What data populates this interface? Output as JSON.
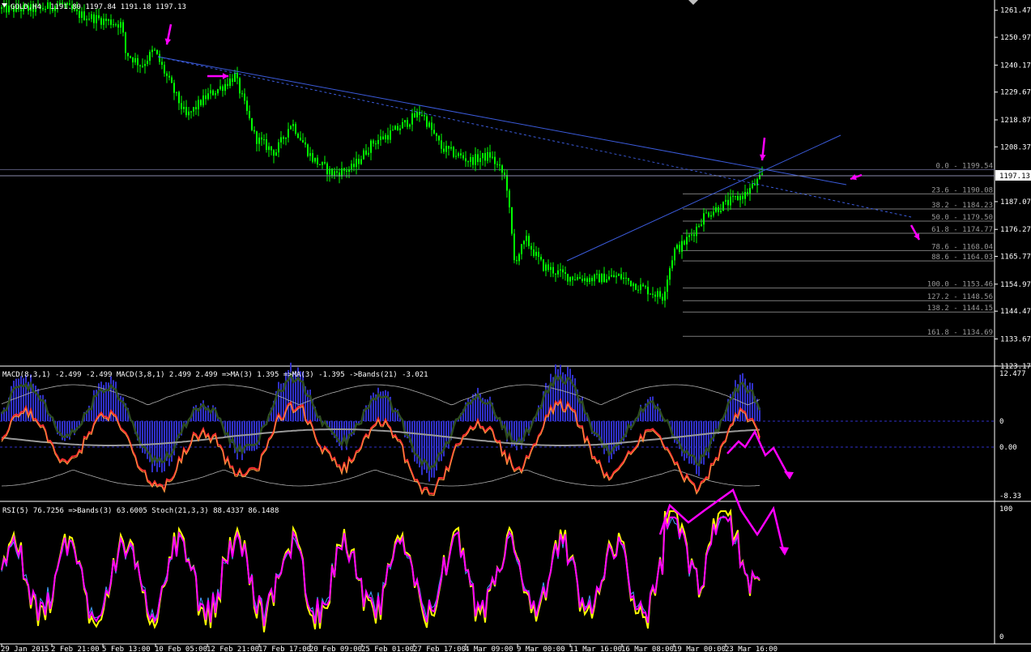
{
  "main": {
    "symbol_label": "GOLD,H4",
    "ohlc_text": "1191.80 1197.84 1191.18 1197.13",
    "current_price_label": "1197.13",
    "current_price": 1197.13,
    "price_ticks": [
      "1261.47",
      "1250.97",
      "1240.17",
      "1229.67",
      "1218.87",
      "1208.37",
      "1197.13",
      "1187.07",
      "1176.27",
      "1165.77",
      "1154.97",
      "1144.47",
      "1133.67",
      "1123.17"
    ],
    "fib_levels": [
      {
        "label": "0.0 - 1199.54",
        "value": 1199.54
      },
      {
        "label": "23.6 - 1190.08",
        "value": 1190.08
      },
      {
        "label": "38.2 - 1184.23",
        "value": 1184.23
      },
      {
        "label": "50.0 - 1179.50",
        "value": 1179.5
      },
      {
        "label": "61.8 - 1174.77",
        "value": 1174.77
      },
      {
        "label": "78.6 - 1168.04",
        "value": 1168.04
      },
      {
        "label": "88.6 - 1164.03",
        "value": 1164.03
      },
      {
        "label": "100.0 - 1153.46",
        "value": 1153.46
      },
      {
        "label": "127.2 - 1148.56",
        "value": 1148.56
      },
      {
        "label": "138.2 - 1144.15",
        "value": 1144.15
      },
      {
        "label": "161.8 - 1134.69",
        "value": 1134.69
      }
    ]
  },
  "macd": {
    "header": "MACD(8,3,1) -2.499 -2.499  MACD(3,8,1) 2.499 2.499  =>MA(3) 1.395  =>MA(3) -1.395  ->Bands(21) -3.021",
    "ticks": [
      "12.477",
      "0",
      "0.00",
      "-8.33"
    ]
  },
  "rsi": {
    "header": "RSI(5) 76.7256  =>Bands(3) 63.6005  Stoch(21,3,3) 88.4337 86.1488",
    "ticks": [
      "100",
      "0"
    ]
  },
  "time_labels": [
    "29 Jan 2015",
    "2 Feb 21:00",
    "5 Feb 13:00",
    "10 Feb 05:00",
    "12 Feb 21:00",
    "17 Feb 17:00",
    "20 Feb 09:00",
    "25 Feb 01:00",
    "27 Feb 17:00",
    "4 Mar 09:00",
    "9 Mar 00:00",
    "11 Mar 16:00",
    "16 Mar 08:00",
    "19 Mar 00:00",
    "23 Mar 16:00"
  ],
  "colors": {
    "background": "#000000",
    "candle": "#00ff00",
    "trendline": "#3b5bdb",
    "fib": "#7a7a7a",
    "arrow": "#ff00ff",
    "macd_hist": "#3030c8",
    "macd_fast": "#ff3030",
    "macd_slow": "#2e4d1f",
    "rsi": "#ffff00",
    "stoch": "#ff00ff",
    "stoch_signal": "#40a0ff"
  },
  "chart_data": {
    "type": "candlestick",
    "symbol": "GOLD",
    "timeframe": "H4",
    "ylim": [
      1123.17,
      1266.0
    ],
    "anchors": [
      [
        0,
        1262
      ],
      [
        10,
        1262
      ],
      [
        50,
        1262
      ],
      [
        75,
        1264
      ],
      [
        95,
        1260
      ],
      [
        150,
        1256
      ],
      [
        155,
        1245
      ],
      [
        175,
        1240
      ],
      [
        190,
        1246
      ],
      [
        230,
        1220
      ],
      [
        255,
        1228
      ],
      [
        275,
        1232
      ],
      [
        290,
        1236
      ],
      [
        315,
        1212
      ],
      [
        340,
        1206
      ],
      [
        360,
        1218
      ],
      [
        385,
        1204
      ],
      [
        410,
        1198
      ],
      [
        435,
        1200
      ],
      [
        460,
        1210
      ],
      [
        485,
        1214
      ],
      [
        520,
        1222
      ],
      [
        545,
        1208
      ],
      [
        580,
        1203
      ],
      [
        605,
        1205
      ],
      [
        625,
        1196
      ],
      [
        635,
        1164
      ],
      [
        650,
        1172
      ],
      [
        670,
        1162
      ],
      [
        700,
        1158
      ],
      [
        730,
        1157
      ],
      [
        765,
        1158
      ],
      [
        790,
        1154
      ],
      [
        818,
        1150
      ],
      [
        832,
        1168
      ],
      [
        842,
        1170
      ],
      [
        858,
        1176
      ],
      [
        870,
        1182
      ],
      [
        895,
        1186
      ],
      [
        920,
        1190
      ],
      [
        942,
        1197
      ]
    ],
    "x_range": [
      0,
      945
    ],
    "macd_zero": 0,
    "macd_ylim": [
      -8.33,
      12.477
    ],
    "rsi_ylim": [
      0,
      100
    ]
  }
}
